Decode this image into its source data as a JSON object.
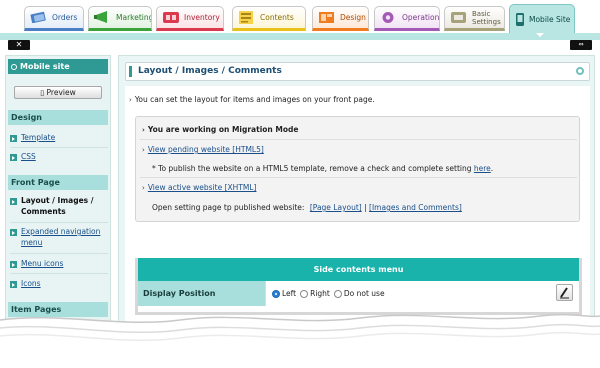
{
  "tabs": [
    {
      "label": "Orders"
    },
    {
      "label": "Marketing"
    },
    {
      "label": "Inventory"
    },
    {
      "label": "Contents"
    },
    {
      "label": "Design"
    },
    {
      "label": "Operations"
    },
    {
      "label": "Basic Settings",
      "line1": "Basic",
      "line2": "Settings"
    },
    {
      "label": "Mobile Site",
      "active": true
    }
  ],
  "toolbar": {
    "close_glyph": "✕",
    "expand_glyph": "⇔"
  },
  "sidebar": {
    "title": "Mobile site",
    "preview_label": "Preview",
    "sections": [
      {
        "title": "Design",
        "items": [
          {
            "label": "Template"
          },
          {
            "label": "CSS"
          }
        ]
      },
      {
        "title": "Front Page",
        "items": [
          {
            "label": "Layout / Images / Comments",
            "current": true
          },
          {
            "label": "Expanded navigation menu"
          },
          {
            "label": "Menu icons"
          },
          {
            "label": "Icons"
          }
        ]
      },
      {
        "title": "Item Pages",
        "items": []
      }
    ]
  },
  "main": {
    "title": "Layout / Images / Comments",
    "intro": "You can set the layout for items and images on your front page.",
    "notice": {
      "mode": "You are working on Migration Mode",
      "pending_link": "View pending website [HTML5]",
      "publish_note_pre": "* To publish the website on a HTML5 template, remove a check and complete setting",
      "publish_note_link": "here",
      "active_link": "View active website [XHTML]",
      "published_label": "Open setting page tp published website:",
      "page_layout_link": "[Page Layout]",
      "separator": "|",
      "images_link": "[Images and Comments]"
    },
    "side_menu": {
      "header": "Side contents menu",
      "position_label": "Display Position",
      "options": [
        {
          "label": "Left",
          "selected": true
        },
        {
          "label": "Right",
          "selected": false
        },
        {
          "label": "Do not use",
          "selected": false
        }
      ],
      "selected_value": "Left"
    }
  },
  "colors": {
    "accent": "#2f9a93",
    "table_header": "#1ab3ac",
    "label_bg": "#a8dfdc",
    "link": "#1a4f8a"
  }
}
